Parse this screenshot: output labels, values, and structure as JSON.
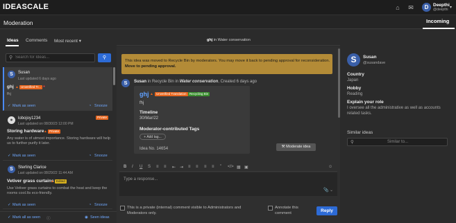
{
  "app": {
    "logo": "IDEASCALE"
  },
  "header": {
    "user_initial": "D",
    "user_name": "Deepthi",
    "user_handle": "@deepthi",
    "page_title": "Moderation",
    "incoming_tab": "Incoming"
  },
  "left": {
    "tabs": [
      "Ideas",
      "Comments",
      "Most recent ▾"
    ],
    "search_placeholder": "Search for Ideas...",
    "cards": [
      {
        "initial": "S",
        "avatar_color": "#3a5fa8",
        "name": "Susan",
        "updated": "Last updated 6 days ago",
        "title": "ghj",
        "badge": "Unverified Tr...",
        "badge2": "",
        "body": "fhj",
        "seen": "Mark as seen",
        "snooze": "Snooze"
      },
      {
        "initial": "",
        "avatar_color": "#dddddd",
        "name": "lobojoy1234",
        "updated": "Last updated on 08/30/23 12:00 PM",
        "title": "Storing hardware",
        "badge": "Private",
        "badge2": "Private",
        "body": "Any water is of utmost importance. Storing hardware will help us to further purify it later.",
        "seen": "Mark as seen",
        "snooze": "Snooze"
      },
      {
        "initial": "S",
        "avatar_color": "#3a5fa8",
        "name": "Sterling Clarice",
        "updated": "Last updated on 08/29/22 11:44 AM",
        "title": "Vetiver grass curtains",
        "badge": "Edited",
        "badge2": "",
        "body": "Use Vetiver grass curtains to combat the heat and keep the rooms cool.Its eco-friendly.",
        "seen": "Mark as seen",
        "snooze": "Snooze"
      }
    ],
    "mark_all": "Mark all as seen",
    "seen_ideas": "Seen ideas"
  },
  "middle": {
    "heading_idea": "ghj",
    "heading_in": "in",
    "heading_campaign": "Water conservation",
    "notice_text": "This idea was moved to Recycle Bin by moderators. You may move it back to pending approval for reconsideration.",
    "notice_link": "Move to pending approval.",
    "commenter": "Susan",
    "comment_meta": "in Recycle Bin in",
    "comment_campaign": "Water conservation",
    "comment_time": ", Created 6 days ago",
    "idea_title": "ghj",
    "badge_unverified": "Unverified Translation",
    "badge_recycle": "Recycling Bin",
    "idea_body": "fhj",
    "timeline_label": "Timeline",
    "timeline_value": "30/Mar/22",
    "tags_label": "Moderator-contributed Tags",
    "add_tag": "+ Add tag...",
    "idea_no": "Idea No. 14654",
    "moderate_btn": "Moderate idea",
    "reply_placeholder": "Type a response...",
    "private_text": "This is a private (internal) comment visible to Administrators and Moderators only.",
    "annotate_text": "Annotate this comment",
    "reply_btn": "Reply"
  },
  "right": {
    "initial": "S",
    "name": "Susan",
    "handle": "@susandave",
    "country_label": "Country",
    "country": "Japan",
    "hobby_label": "Hobby",
    "hobby": "Reading",
    "role_label": "Explain your role",
    "role": "I oversee all the administrative as well as accounts related tasks.",
    "similar_label": "Similar ideas",
    "similar_placeholder": "Similar to..."
  },
  "colors": {
    "accent": "#2d6bd6",
    "link": "#5fa0ff",
    "notice": "#b38b37",
    "badge_orange": "#e8661e",
    "badge_green": "#3a8f2e",
    "badge_yellow": "#d9b21e"
  }
}
